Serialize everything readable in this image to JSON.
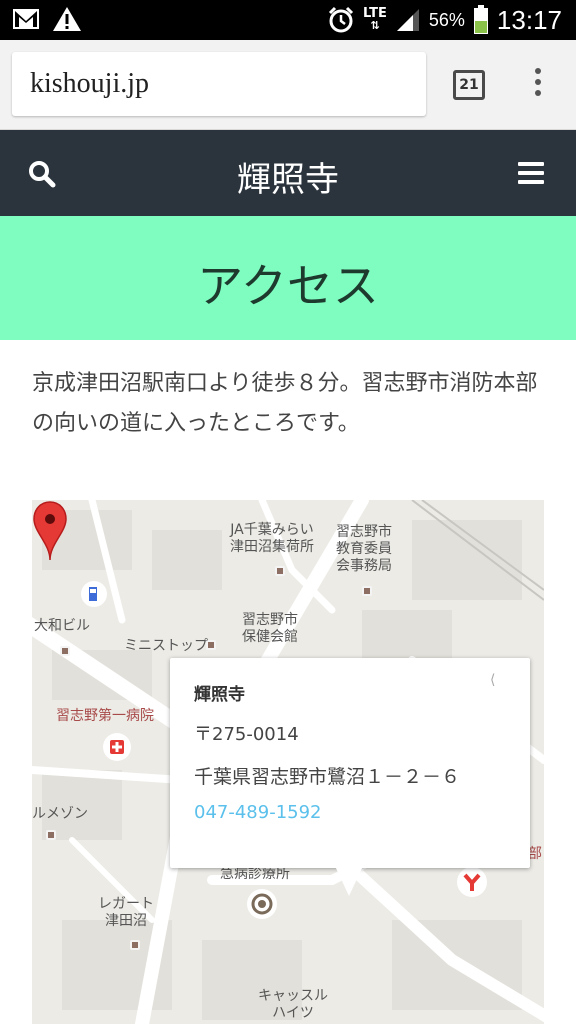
{
  "status_bar": {
    "lte": "LTE",
    "battery_pct": "56%",
    "time": "13:17"
  },
  "browser": {
    "url": "kishouji.jp",
    "tab_count": "21"
  },
  "header": {
    "site_title": "輝照寺"
  },
  "page": {
    "heading": "アクセス",
    "intro": "京成津田沼駅南口より徒歩８分。習志野市消防本部の向いの道に入ったところです。"
  },
  "map": {
    "labels": {
      "ja_line1": "JA千葉みらい",
      "ja_line2": "津田沼集荷所",
      "edu_line1": "習志野市",
      "edu_line2": "教育委員",
      "edu_line3": "会事務局",
      "yamato": "大和ビル",
      "health_line1": "習志野市",
      "health_line2": "保健会館",
      "ministop": "ミニストップ",
      "hospital": "習志野第一病院",
      "maison": "ルメゾン",
      "clinic": "急病診療所",
      "regato_line1": "レガート",
      "regato_line2": "津田沼",
      "castle_line1": "キャッスル",
      "castle_line2": "ハイツ",
      "bu": "部"
    },
    "info": {
      "name": "輝照寺",
      "zip": "〒275-0014",
      "address": "千葉県習志野市鷺沼１－２－６",
      "phone": "047-489-1592"
    }
  },
  "colors": {
    "header_bg": "#2b333d",
    "hero_bg": "#7ffcc0",
    "pin": "#e53935",
    "phone_link": "#5bc0eb"
  }
}
